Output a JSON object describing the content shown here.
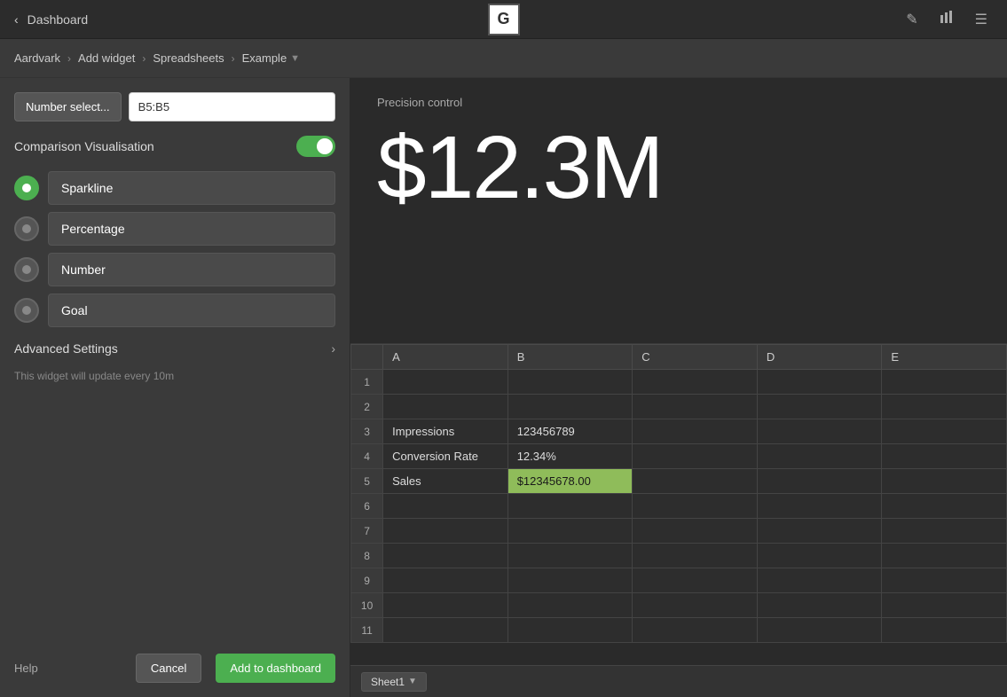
{
  "topnav": {
    "dashboard_label": "Dashboard",
    "back_arrow": "‹",
    "g_logo": "G"
  },
  "breadcrumb": {
    "items": [
      {
        "label": "Aardvark"
      },
      {
        "label": "Add widget"
      },
      {
        "label": "Spreadsheets"
      },
      {
        "label": "Example"
      }
    ],
    "chevron": "›"
  },
  "nav_icons": {
    "edit": "✎",
    "chart": "▌▌▌",
    "menu": "☰"
  },
  "left_panel": {
    "number_select_btn": "Number select...",
    "cell_ref_value": "B5:B5",
    "cell_ref_placeholder": "B5:B5",
    "comparison_visualisation_label": "Comparison Visualisation",
    "radio_options": [
      {
        "label": "Sparkline",
        "active": true
      },
      {
        "label": "Percentage",
        "active": false
      },
      {
        "label": "Number",
        "active": false
      },
      {
        "label": "Goal",
        "active": false
      }
    ],
    "advanced_settings_label": "Advanced Settings",
    "update_info": "This widget will update every 10m",
    "help_label": "Help",
    "cancel_label": "Cancel",
    "add_label": "Add to dashboard"
  },
  "right_panel": {
    "precision_control_label": "Precision control",
    "big_value": "$12.3M"
  },
  "spreadsheet": {
    "columns": [
      "A",
      "B",
      "C",
      "D",
      "E"
    ],
    "rows": [
      {
        "num": "1",
        "cells": [
          "",
          "",
          "",
          "",
          ""
        ]
      },
      {
        "num": "2",
        "cells": [
          "",
          "",
          "",
          "",
          ""
        ]
      },
      {
        "num": "3",
        "cells": [
          "Impressions",
          "123456789",
          "",
          "",
          ""
        ]
      },
      {
        "num": "4",
        "cells": [
          "Conversion Rate",
          "12.34%",
          "",
          "",
          ""
        ]
      },
      {
        "num": "5",
        "cells": [
          "Sales",
          "$12345678.00",
          "",
          "",
          ""
        ],
        "highlight_col": 1
      },
      {
        "num": "6",
        "cells": [
          "",
          "",
          "",
          "",
          ""
        ]
      },
      {
        "num": "7",
        "cells": [
          "",
          "",
          "",
          "",
          ""
        ]
      },
      {
        "num": "8",
        "cells": [
          "",
          "",
          "",
          "",
          ""
        ]
      },
      {
        "num": "9",
        "cells": [
          "",
          "",
          "",
          "",
          ""
        ]
      },
      {
        "num": "10",
        "cells": [
          "",
          "",
          "",
          "",
          ""
        ]
      },
      {
        "num": "11",
        "cells": [
          "",
          "",
          "",
          "",
          ""
        ]
      }
    ],
    "sheet_tab": "Sheet1"
  }
}
